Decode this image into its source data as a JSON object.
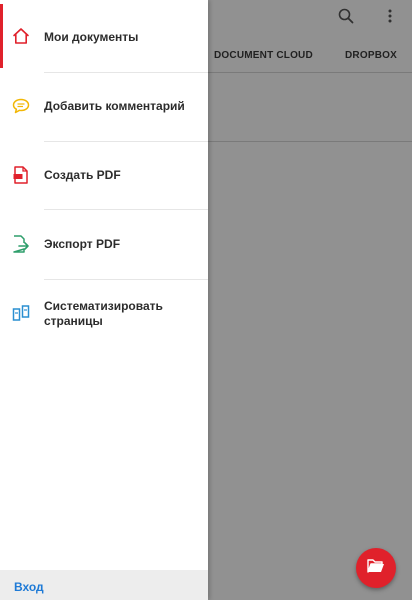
{
  "app": {
    "tabs": [
      "DOCUMENT CLOUD",
      "DROPBOX"
    ],
    "search_icon": "search-icon",
    "more_icon": "more-vert-icon",
    "fab_icon": "folder-open-icon"
  },
  "drawer": {
    "items": [
      {
        "label": "Мои документы",
        "icon": "home-icon",
        "active": true
      },
      {
        "label": "Добавить комментарий",
        "icon": "comment-icon"
      },
      {
        "label": "Создать PDF",
        "icon": "create-pdf-icon"
      },
      {
        "label": "Экспорт PDF",
        "icon": "export-pdf-icon"
      },
      {
        "label": "Систематизировать страницы",
        "icon": "organize-pages-icon"
      }
    ],
    "footer": {
      "sign_in_label": "Вход"
    }
  },
  "colors": {
    "accent": "#e0212b",
    "link": "#1e7ad6",
    "comment_icon": "#f2b705",
    "export_icon": "#2e9e6b",
    "organize_icon": "#2a8fd1"
  }
}
